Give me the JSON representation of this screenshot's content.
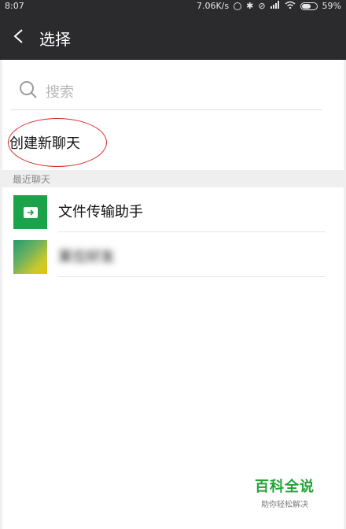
{
  "status_bar": {
    "time": "8:07",
    "net_speed": "7.06K/s",
    "battery": "59%"
  },
  "header": {
    "title": "选择"
  },
  "search": {
    "placeholder": "搜索"
  },
  "new_chat": {
    "label": "创建新聊天"
  },
  "recent": {
    "section_label": "最近聊天",
    "items": [
      {
        "name": "文件传输助手",
        "avatar": "file-transfer-icon",
        "color": "#1aa34a"
      },
      {
        "name": "某位好友",
        "avatar": "gradient-avatar",
        "blurred": true
      }
    ]
  },
  "watermark": {
    "title": "百科全说",
    "subtitle": "助你轻松解决"
  },
  "colors": {
    "header_bg": "#2b2b2d",
    "highlight": "#d9262b",
    "brand_green": "#21a336"
  }
}
